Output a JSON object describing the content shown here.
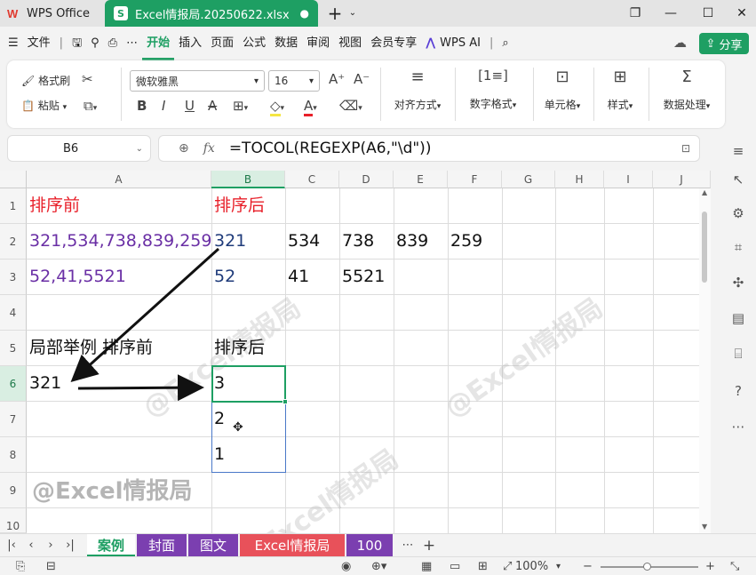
{
  "titlebar": {
    "app_name": "WPS Office",
    "doc_tab": "Excel情报局.20250622.xlsx",
    "app_icon": "wps-logo",
    "doc_icon": "S"
  },
  "menu": {
    "file": "文件",
    "items": [
      "开始",
      "插入",
      "页面",
      "公式",
      "数据",
      "审阅",
      "视图",
      "会员专享"
    ],
    "wps_ai": "WPS AI",
    "share": "分享"
  },
  "ribbon": {
    "format_painter": "格式刷",
    "paste": "粘贴",
    "font_name": "微软雅黑",
    "font_size": "16",
    "align": "对齐方式",
    "number_format": "数字格式",
    "cell": "单元格",
    "style": "样式",
    "data_process": "数据处理",
    "bold": "B",
    "italic": "I",
    "underline": "U",
    "strike": "A",
    "font_color_accent": "#e8202a",
    "fill_color_accent": "#f5e642"
  },
  "formula_bar": {
    "name_box": "B6",
    "fx": "fx",
    "formula": "=TOCOL(REGEXP(A6,\"\\d\"))"
  },
  "grid": {
    "columns": [
      "A",
      "B",
      "C",
      "D",
      "E",
      "F",
      "G",
      "H",
      "I",
      "J"
    ],
    "rows": [
      "1",
      "2",
      "3",
      "4",
      "5",
      "6",
      "7",
      "8",
      "9",
      "10"
    ],
    "selected_column": "B",
    "selected_row": "6",
    "cells": {
      "A1": "排序前",
      "B1": "排序后",
      "A2": "321,534,738,839,259",
      "B2": "321",
      "C2": "534",
      "D2": "738",
      "E2": "839",
      "F2": "259",
      "A3": "52,41,5521",
      "B3": "52",
      "C3": "41",
      "D3": "5521",
      "A5": "局部举例 排序前",
      "B5": "排序后",
      "A6": "321",
      "B6": "3",
      "B7": "2",
      "B8": "1",
      "A9": "@Excel情报局"
    },
    "watermark": "@Excel情报局"
  },
  "sheet_tabs": [
    {
      "label": "案例",
      "color": "#ffffff",
      "active": true
    },
    {
      "label": "封面",
      "color": "#7b3fb0"
    },
    {
      "label": "图文",
      "color": "#7b3fb0"
    },
    {
      "label": "Excel情报局",
      "color": "#e8515a"
    },
    {
      "label": "100",
      "color": "#7b3fb0"
    }
  ],
  "statusbar": {
    "zoom": "100%"
  }
}
